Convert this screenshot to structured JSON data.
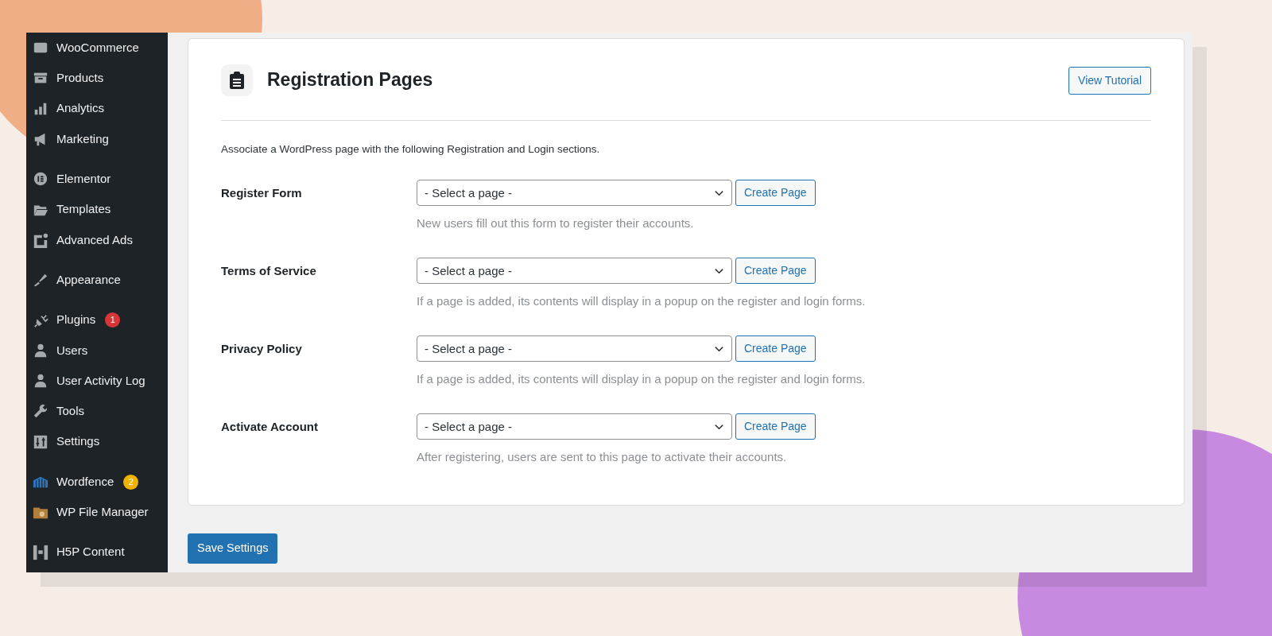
{
  "sidebar": {
    "groups": [
      [
        {
          "label": "WooCommerce"
        },
        {
          "label": "Products"
        },
        {
          "label": "Analytics"
        },
        {
          "label": "Marketing"
        }
      ],
      [
        {
          "label": "Elementor"
        },
        {
          "label": "Templates"
        },
        {
          "label": "Advanced Ads"
        }
      ],
      [
        {
          "label": "Appearance"
        }
      ],
      [
        {
          "label": "Plugins",
          "badge": "1",
          "color": "#d63638"
        },
        {
          "label": "Users"
        },
        {
          "label": "User Activity Log"
        },
        {
          "label": "Tools"
        },
        {
          "label": "Settings"
        }
      ],
      [
        {
          "label": "Wordfence",
          "badge": "2",
          "color": "#f0b400"
        },
        {
          "label": "WP File Manager"
        }
      ],
      [
        {
          "label": "H5P Content"
        }
      ]
    ]
  },
  "panel": {
    "title": "Registration Pages",
    "tutorial_button": "View Tutorial",
    "description": "Associate a WordPress page with the following Registration and Login sections.",
    "rows": [
      {
        "label": "Register Form",
        "value": "- Select a page -",
        "button": "Create Page",
        "help": "New users fill out this form to register their accounts."
      },
      {
        "label": "Terms of Service",
        "value": "- Select a page -",
        "button": "Create Page",
        "help": "If a page is added, its contents will display in a popup on the register and login forms."
      },
      {
        "label": "Privacy Policy",
        "value": "- Select a page -",
        "button": "Create Page",
        "help": "If a page is added, its contents will display in a popup on the register and login forms."
      },
      {
        "label": "Activate Account",
        "value": "- Select a page -",
        "button": "Create Page",
        "help": "After registering, users are sent to this page to activate their accounts."
      }
    ]
  },
  "save_button": "Save Settings"
}
